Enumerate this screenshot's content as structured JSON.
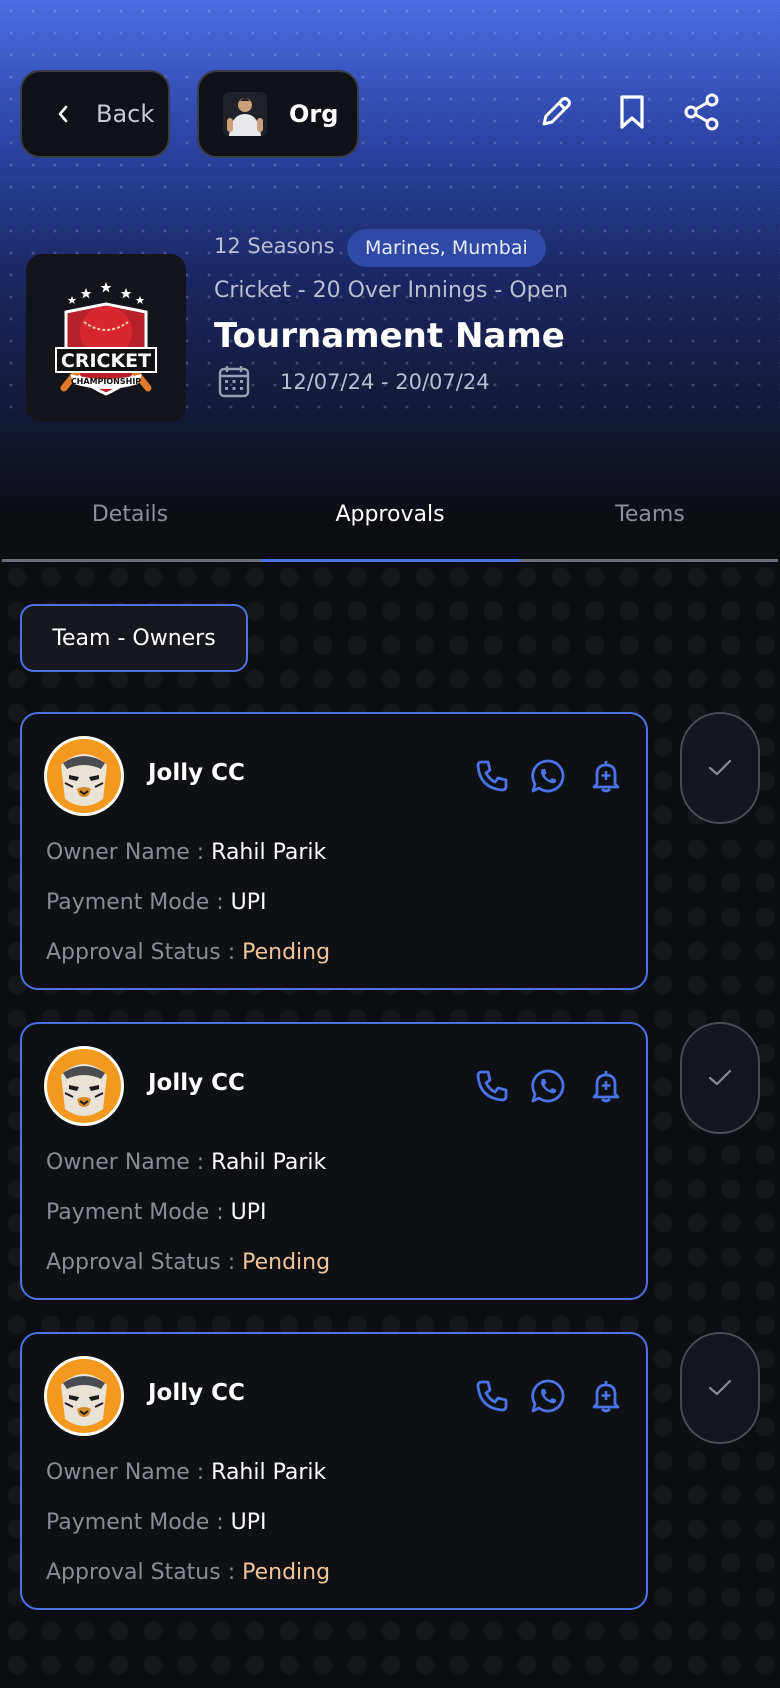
{
  "header": {
    "back_label": "Back",
    "org_label": "Org",
    "icons": [
      "pencil-icon",
      "bookmark-icon",
      "share-icon"
    ]
  },
  "tournament": {
    "seasons": "12 Seasons",
    "location": "Marines, Mumbai",
    "subtitle": "Cricket - 20 Over Innings - Open",
    "name": "Tournament Name",
    "dates": "12/07/24 - 20/07/24",
    "logo_text": "CRICKET",
    "logo_ribbon": "CHAMPIONSHIP"
  },
  "tabs": [
    {
      "label": "Details",
      "active": false
    },
    {
      "label": "Approvals",
      "active": true
    },
    {
      "label": "Teams",
      "active": false
    }
  ],
  "filter": {
    "label": "Team - Owners"
  },
  "labels": {
    "owner": "Owner Name : ",
    "payment": "Payment Mode : ",
    "status": "Approval Status : "
  },
  "cards": [
    {
      "team": "Jolly CC",
      "owner": "Rahil Parik",
      "payment": "UPI",
      "status": "Pending"
    },
    {
      "team": "Jolly CC",
      "owner": "Rahil Parik",
      "payment": "UPI",
      "status": "Pending"
    },
    {
      "team": "Jolly CC",
      "owner": "Rahil Parik",
      "payment": "UPI",
      "status": "Pending"
    }
  ],
  "colors": {
    "accent": "#4a73e6",
    "pending": "#f2c59a",
    "team_avatar": "#f39a1e"
  }
}
